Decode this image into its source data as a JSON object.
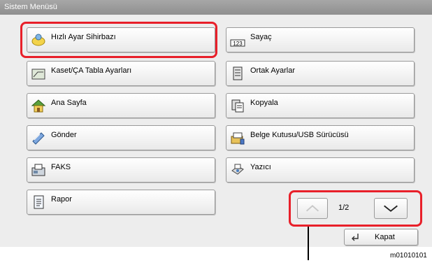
{
  "window": {
    "title": "Sistem Menüsü"
  },
  "menu": {
    "quick_setup": "Hızlı Ayar Sihirbazı",
    "counter": "Sayaç",
    "cassette": "Kaset/ÇA Tabla Ayarları",
    "common": "Ortak Ayarlar",
    "home": "Ana Sayfa",
    "copy": "Kopyala",
    "send": "Gönder",
    "document_box": "Belge Kutusu/USB Sürücüsü",
    "fax": "FAKS",
    "printer": "Yazıcı",
    "report": "Rapor"
  },
  "pager": {
    "current": "1/2"
  },
  "close": {
    "label": "Kapat"
  },
  "caption": "m01010101",
  "colors": {
    "highlight": "#e8202a",
    "titlebar": "#9a9a9a"
  }
}
